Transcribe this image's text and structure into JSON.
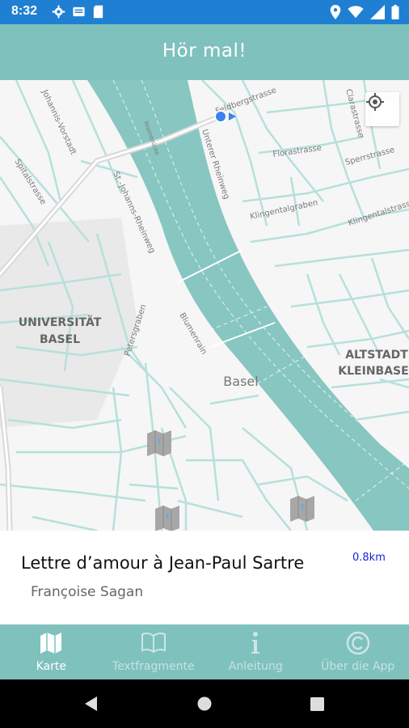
{
  "status_bar": {
    "time": "8:32"
  },
  "app_bar": {
    "title": "Hör mal!"
  },
  "map": {
    "area_labels": [
      "UNIVERSITÄT",
      "BASEL",
      "ALTSTADT",
      "KLEINBASE"
    ],
    "city_label": "Basel",
    "street_labels": [
      "Feldbergstrasse",
      "Johannis-Vorstadt",
      "Spitalstrasse",
      "St.-Johanns-Rheinweg",
      "Unterer Rheinweg",
      "Florastrasse",
      "Klingentalgraben",
      "Sperrstrasse",
      "Klingentalstrasse",
      "Clarastrasse",
      "Petersgraben",
      "Blumenrain",
      "Rheinbrücke"
    ],
    "colors": {
      "water": "#88c6c1",
      "roads": "#b6e0dc",
      "land": "#f6f6f6"
    }
  },
  "info_card": {
    "title": "Lettre d’amour à Jean-Paul Sartre",
    "distance": "0.8km",
    "author": "Françoise Sagan"
  },
  "bottom_nav": {
    "items": [
      {
        "label": "Karte",
        "icon": "map-icon",
        "active": true
      },
      {
        "label": "Textfragmente",
        "icon": "book-icon",
        "active": false
      },
      {
        "label": "Anleitung",
        "icon": "info-icon",
        "active": false
      },
      {
        "label": "Über die App",
        "icon": "copyright-icon",
        "active": false
      }
    ]
  }
}
